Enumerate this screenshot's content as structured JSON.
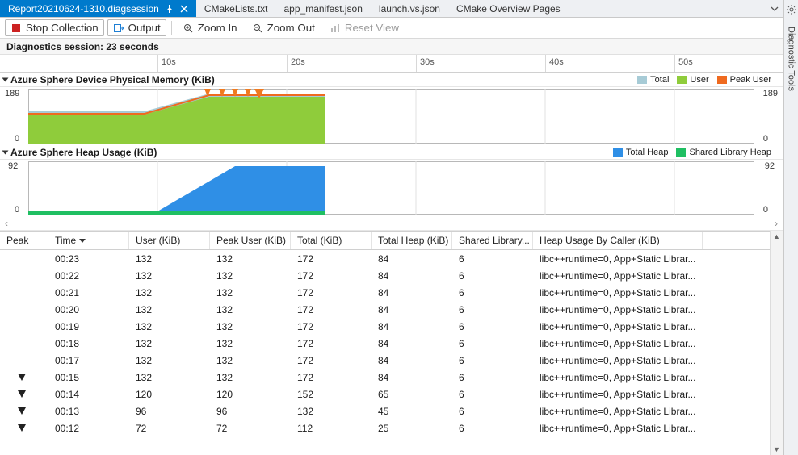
{
  "tabs": {
    "active": "Report20210624-1310.diagsession",
    "others": [
      "CMakeLists.txt",
      "app_manifest.json",
      "launch.vs.json",
      "CMake Overview Pages"
    ]
  },
  "toolbar": {
    "stop": "Stop Collection",
    "output": "Output",
    "zoom_in": "Zoom In",
    "zoom_out": "Zoom Out",
    "reset_view": "Reset View"
  },
  "session_label": "Diagnostics session: 23 seconds",
  "ruler_ticks": [
    "10s",
    "20s",
    "30s",
    "40s",
    "50s"
  ],
  "chart1": {
    "title": "Azure Sphere Device Physical Memory (KiB)",
    "ymax": "189",
    "ymin": "0",
    "legend": [
      {
        "label": "Total",
        "color": "#a7cbd6"
      },
      {
        "label": "User",
        "color": "#8fcc3b"
      },
      {
        "label": "Peak User",
        "color": "#ef6a1f"
      }
    ]
  },
  "chart2": {
    "title": "Azure Sphere Heap Usage (KiB)",
    "ymax": "92",
    "ymin": "0",
    "legend": [
      {
        "label": "Total Heap",
        "color": "#2f8fe6"
      },
      {
        "label": "Shared Library Heap",
        "color": "#1fbf62"
      }
    ]
  },
  "chart_data": [
    {
      "type": "area",
      "title": "Azure Sphere Device Physical Memory (KiB)",
      "xlabel": "seconds",
      "ylabel": "KiB",
      "xlim": [
        0,
        23
      ],
      "ylim": [
        0,
        189
      ],
      "series": [
        {
          "name": "Total",
          "color": "#a7cbd6",
          "x": [
            0,
            9,
            14,
            23
          ],
          "y": [
            110,
            110,
            172,
            172
          ]
        },
        {
          "name": "User",
          "color": "#8fcc3b",
          "x": [
            0,
            9,
            14,
            23
          ],
          "y": [
            100,
            100,
            160,
            160
          ]
        },
        {
          "name": "Peak User",
          "color": "#ef6a1f",
          "x": [
            0,
            9,
            14,
            23
          ],
          "y": [
            102,
            102,
            165,
            165
          ]
        }
      ],
      "markers_x": [
        14,
        15,
        16,
        17,
        18
      ]
    },
    {
      "type": "area",
      "title": "Azure Sphere Heap Usage (KiB)",
      "xlabel": "seconds",
      "ylabel": "KiB",
      "xlim": [
        0,
        23
      ],
      "ylim": [
        0,
        92
      ],
      "series": [
        {
          "name": "Total Heap",
          "color": "#2f8fe6",
          "x": [
            0,
            10,
            16,
            23
          ],
          "y": [
            6,
            6,
            84,
            84
          ]
        },
        {
          "name": "Shared Library Heap",
          "color": "#1fbf62",
          "x": [
            0,
            23
          ],
          "y": [
            6,
            6
          ]
        }
      ]
    }
  ],
  "columns": [
    "Peak",
    "Time",
    "User (KiB)",
    "Peak User (KiB)",
    "Total (KiB)",
    "Total Heap (KiB)",
    "Shared Library...",
    "Heap Usage By Caller (KiB)"
  ],
  "sort_column_index": 1,
  "heap_caller_text": "libc++runtime=0, App+Static Librar...",
  "rows": [
    {
      "peak": false,
      "time": "00:23",
      "user": "132",
      "peak_user": "132",
      "total": "172",
      "total_heap": "84",
      "shared": "6"
    },
    {
      "peak": false,
      "time": "00:22",
      "user": "132",
      "peak_user": "132",
      "total": "172",
      "total_heap": "84",
      "shared": "6"
    },
    {
      "peak": false,
      "time": "00:21",
      "user": "132",
      "peak_user": "132",
      "total": "172",
      "total_heap": "84",
      "shared": "6"
    },
    {
      "peak": false,
      "time": "00:20",
      "user": "132",
      "peak_user": "132",
      "total": "172",
      "total_heap": "84",
      "shared": "6"
    },
    {
      "peak": false,
      "time": "00:19",
      "user": "132",
      "peak_user": "132",
      "total": "172",
      "total_heap": "84",
      "shared": "6"
    },
    {
      "peak": false,
      "time": "00:18",
      "user": "132",
      "peak_user": "132",
      "total": "172",
      "total_heap": "84",
      "shared": "6"
    },
    {
      "peak": false,
      "time": "00:17",
      "user": "132",
      "peak_user": "132",
      "total": "172",
      "total_heap": "84",
      "shared": "6"
    },
    {
      "peak": true,
      "time": "00:15",
      "user": "132",
      "peak_user": "132",
      "total": "172",
      "total_heap": "84",
      "shared": "6"
    },
    {
      "peak": true,
      "time": "00:14",
      "user": "120",
      "peak_user": "120",
      "total": "152",
      "total_heap": "65",
      "shared": "6"
    },
    {
      "peak": true,
      "time": "00:13",
      "user": "96",
      "peak_user": "96",
      "total": "132",
      "total_heap": "45",
      "shared": "6"
    },
    {
      "peak": true,
      "time": "00:12",
      "user": "72",
      "peak_user": "72",
      "total": "112",
      "total_heap": "25",
      "shared": "6"
    }
  ],
  "side_panel_label": "Diagnostic Tools"
}
